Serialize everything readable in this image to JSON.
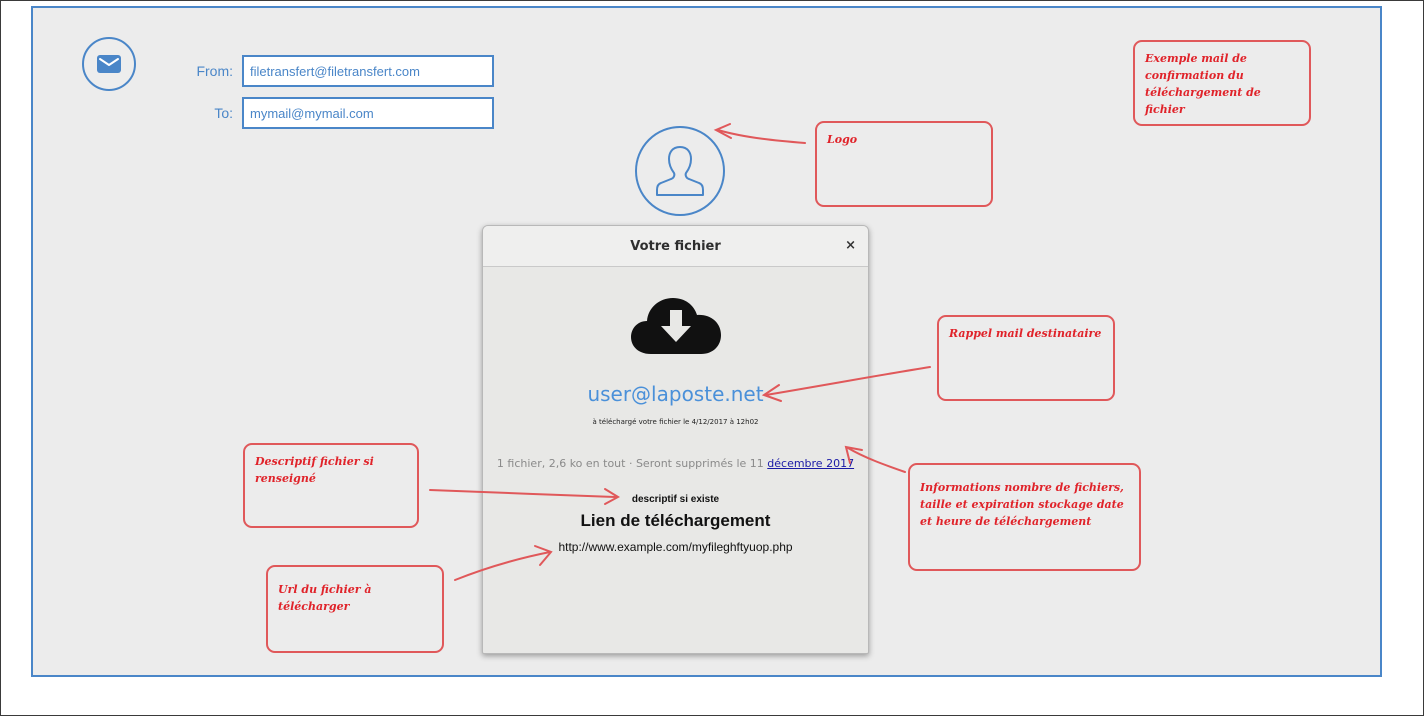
{
  "email": {
    "from_label": "From:",
    "from_value": "filetransfert@filetransfert.com",
    "to_label": "To:",
    "to_value": "mymail@mymail.com"
  },
  "dialog": {
    "title": "Votre fichier",
    "close_glyph": "×",
    "recipient": "user@laposte.net",
    "uploaded_text": "à téléchargé votre fichier le 4/12/2017 à 12h02",
    "info_text": "1 fichier, 2,6 ko en tout  ·  Seront supprimés le 11 ",
    "info_link": "décembre 2017",
    "description": "descriptif si existe",
    "link_title": "Lien de téléchargement",
    "link_url": "http://www.example.com/myfileghftyuop.php"
  },
  "annotations": {
    "example": "Exemple mail de confirmation du téléchargement de  fichier",
    "logo": "Logo",
    "recipient_reminder": "Rappel mail destinataire",
    "description": "Descriptif fichier si renseigné",
    "info": "Informations nombre de fichiers, taille et expiration stockage date et heure de téléchargement",
    "url": "Url du fichier à télécharger"
  },
  "icons": [
    "mail-icon",
    "user-icon",
    "cloud-download-icon",
    "close-icon"
  ],
  "colors": {
    "accent_blue": "#4a86c8",
    "annotation_red": "#e0232a",
    "link_blue": "#1a1aa6",
    "canvas_bg": "#ececec"
  }
}
